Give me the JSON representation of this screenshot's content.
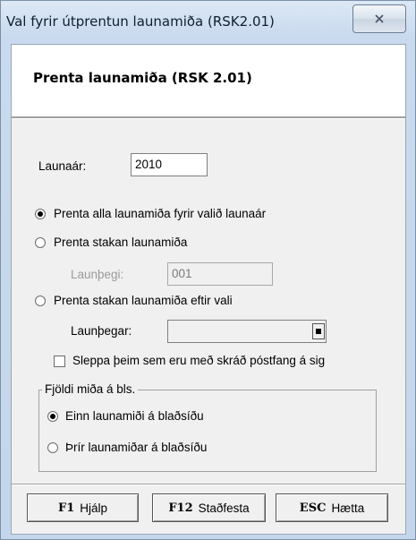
{
  "window": {
    "title": "Val fyrir útprentun launamiða (RSK2.01)"
  },
  "header": {
    "title": "Prenta launamiða (RSK 2.01)"
  },
  "form": {
    "year_label": "Launaár:",
    "year_value": "2010",
    "option_all": "Prenta alla launamiða fyrir valið launaár",
    "option_single": "Prenta stakan launamiða",
    "employee_label": "Launþegi:",
    "employee_value": "001",
    "option_selection": "Prenta stakan launamiða eftir vali",
    "employees_label": "Launþegar:",
    "employees_value": "",
    "skip_checkbox": "Sleppa þeim sem eru með skráð póstfang á sig",
    "selected_option": "option_all"
  },
  "per_page": {
    "legend": "Fjöldi miða á bls.",
    "one": "Einn launamiði á blaðsíðu",
    "three": "Þrír launamiðar á blaðsíðu",
    "selected": "one"
  },
  "buttons": {
    "help_key": "F1",
    "help_label": "Hjálp",
    "confirm_key": "F12",
    "confirm_label": "Staðfesta",
    "cancel_key": "ESC",
    "cancel_label": "Hætta"
  },
  "colors": {
    "window_chrome": "#c9daee",
    "client_bg": "#f0f0f0",
    "header_bg": "#ffffff"
  }
}
